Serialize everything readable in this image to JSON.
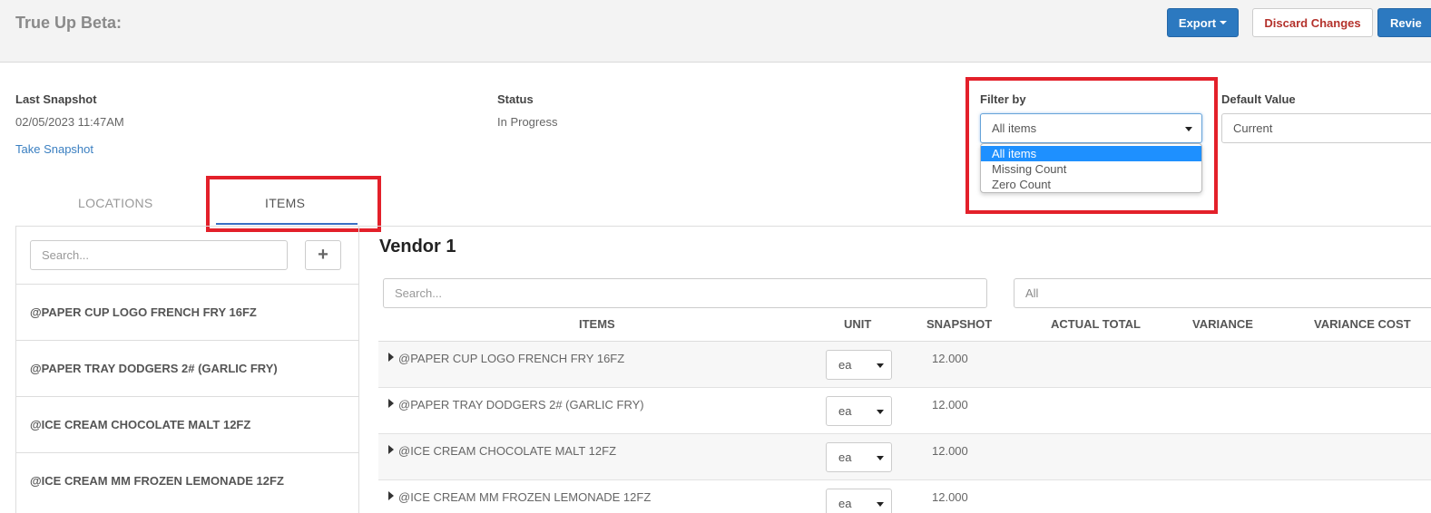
{
  "header": {
    "title": "True Up Beta:",
    "export_label": "Export",
    "discard_label": "Discard Changes",
    "review_label": "Revie"
  },
  "info": {
    "last_snapshot_label": "Last Snapshot",
    "last_snapshot_value": "02/05/2023 11:47AM",
    "take_snapshot_label": "Take Snapshot",
    "status_label": "Status",
    "status_value": "In Progress"
  },
  "filter": {
    "label": "Filter by",
    "selected": "All items",
    "options": [
      "All items",
      "Missing Count",
      "Zero Count"
    ]
  },
  "default_value": {
    "label": "Default Value",
    "selected": "Current"
  },
  "tabs": {
    "locations": "LOCATIONS",
    "items": "ITEMS"
  },
  "left_panel": {
    "search_placeholder": "Search...",
    "add_label": "+",
    "items": [
      "@PAPER CUP LOGO FRENCH FRY 16FZ",
      "@PAPER TRAY DODGERS 2# (GARLIC FRY)",
      "@ICE CREAM CHOCOLATE MALT 12FZ",
      "@ICE CREAM MM FROZEN LEMONADE 12FZ"
    ]
  },
  "main": {
    "vendor_title": "Vendor 1",
    "search_placeholder": "Search...",
    "filter_all": "All",
    "columns": [
      "ITEMS",
      "UNIT",
      "SNAPSHOT",
      "ACTUAL TOTAL",
      "VARIANCE",
      "VARIANCE COST"
    ],
    "rows": [
      {
        "name": "@PAPER CUP LOGO FRENCH FRY 16FZ",
        "unit": "ea",
        "snapshot": "12.000"
      },
      {
        "name": "@PAPER TRAY DODGERS 2# (GARLIC FRY)",
        "unit": "ea",
        "snapshot": "12.000"
      },
      {
        "name": "@ICE CREAM CHOCOLATE MALT 12FZ",
        "unit": "ea",
        "snapshot": "12.000"
      },
      {
        "name": "@ICE CREAM MM FROZEN LEMONADE 12FZ",
        "unit": "ea",
        "snapshot": "12.000"
      }
    ]
  },
  "colors": {
    "primary": "#2c79c0",
    "danger": "#b4322c",
    "highlight": "#e3202a",
    "link": "#3a7fc1",
    "option_selected": "#1e90ff"
  }
}
